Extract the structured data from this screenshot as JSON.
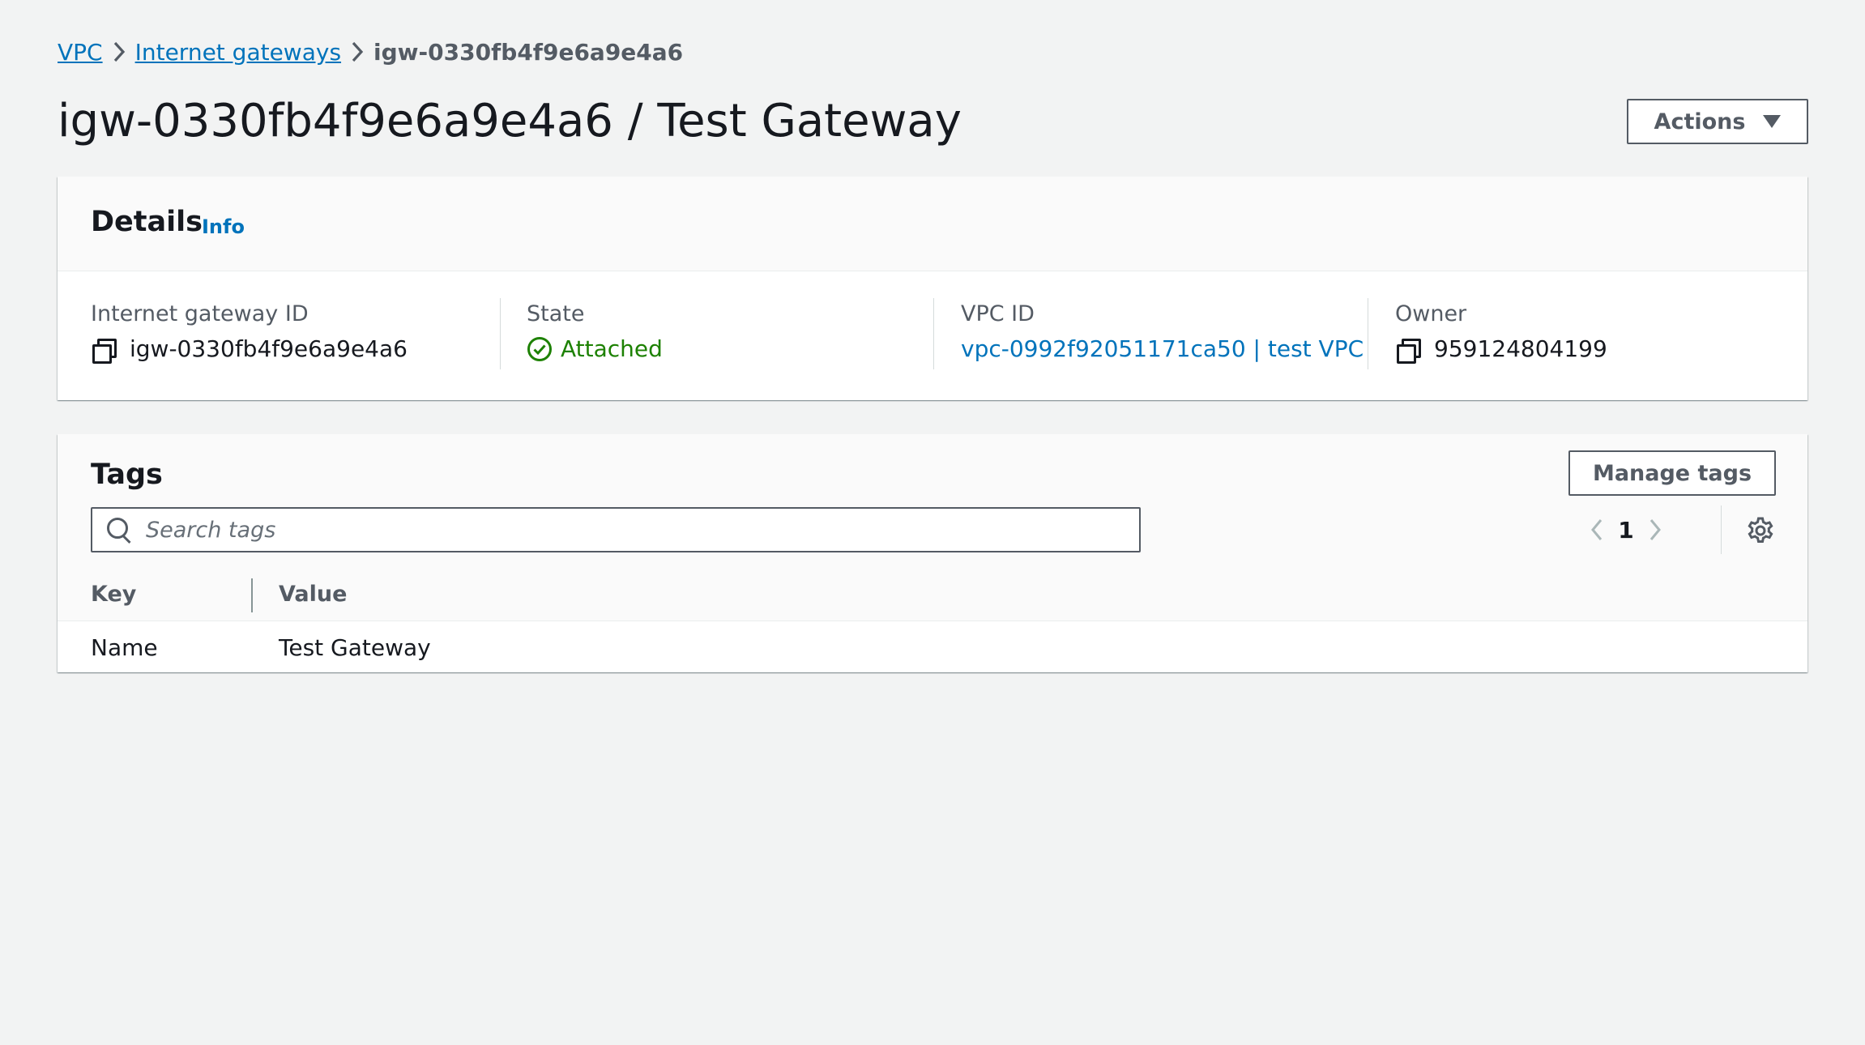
{
  "breadcrumb": {
    "items": [
      {
        "label": "VPC"
      },
      {
        "label": "Internet gateways"
      }
    ],
    "current": "igw-0330fb4f9e6a9e4a6"
  },
  "page": {
    "title": "igw-0330fb4f9e6a9e4a6 / Test Gateway",
    "actions_label": "Actions"
  },
  "details": {
    "title": "Details",
    "info_label": "Info",
    "fields": [
      {
        "label": "Internet gateway ID",
        "value": "igw-0330fb4f9e6a9e4a6",
        "icon": "copy-icon"
      },
      {
        "label": "State",
        "value": "Attached",
        "icon": "check-circle-icon",
        "color": "#1d8102"
      },
      {
        "label": "VPC ID",
        "value": "vpc-0992f92051171ca50 | test VPC",
        "link": true
      },
      {
        "label": "Owner",
        "value": "959124804199",
        "icon": "copy-icon"
      }
    ]
  },
  "tags": {
    "title": "Tags",
    "manage_label": "Manage tags",
    "search_placeholder": "Search tags",
    "page": "1",
    "columns": [
      "Key",
      "Value"
    ],
    "rows": [
      {
        "key": "Name",
        "value": "Test Gateway"
      }
    ]
  },
  "colors": {
    "link": "#0073bb",
    "success": "#1d8102",
    "background": "#f2f3f3"
  }
}
